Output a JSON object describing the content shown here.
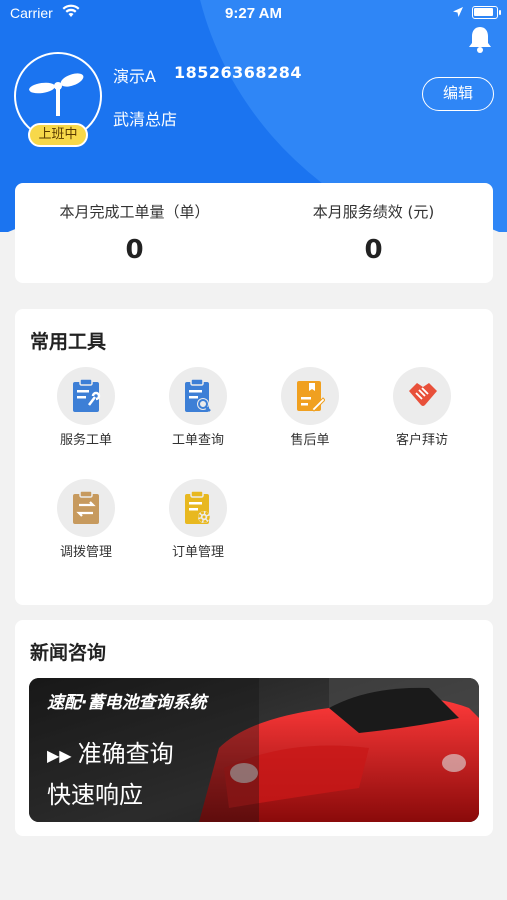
{
  "status_bar": {
    "carrier": "Carrier",
    "time": "9:27 AM"
  },
  "profile": {
    "name": "演示A",
    "phone": "18526368284",
    "store": "武清总店",
    "status_badge": "上班中",
    "edit_label": "编辑"
  },
  "stats": [
    {
      "label": "本月完成工单量（单）",
      "value": "0"
    },
    {
      "label": "本月服务绩效 (元)",
      "value": "0"
    }
  ],
  "tools": {
    "title": "常用工具",
    "items": [
      {
        "label": "服务工单",
        "icon": "service-order-icon",
        "color": "#3d7fd6"
      },
      {
        "label": "工单查询",
        "icon": "order-search-icon",
        "color": "#3d7fd6"
      },
      {
        "label": "售后单",
        "icon": "after-sales-icon",
        "color": "#f0a020"
      },
      {
        "label": "客户拜访",
        "icon": "handshake-icon",
        "color": "#e8503a"
      },
      {
        "label": "调拨管理",
        "icon": "transfer-icon",
        "color": "#c79a5e"
      },
      {
        "label": "订单管理",
        "icon": "order-manage-icon",
        "color": "#e8b820"
      }
    ]
  },
  "news": {
    "title": "新闻咨询",
    "banner_title": "速配·蓄电池查询系统",
    "banner_line1": "准确查询",
    "banner_line2": "快速响应"
  }
}
